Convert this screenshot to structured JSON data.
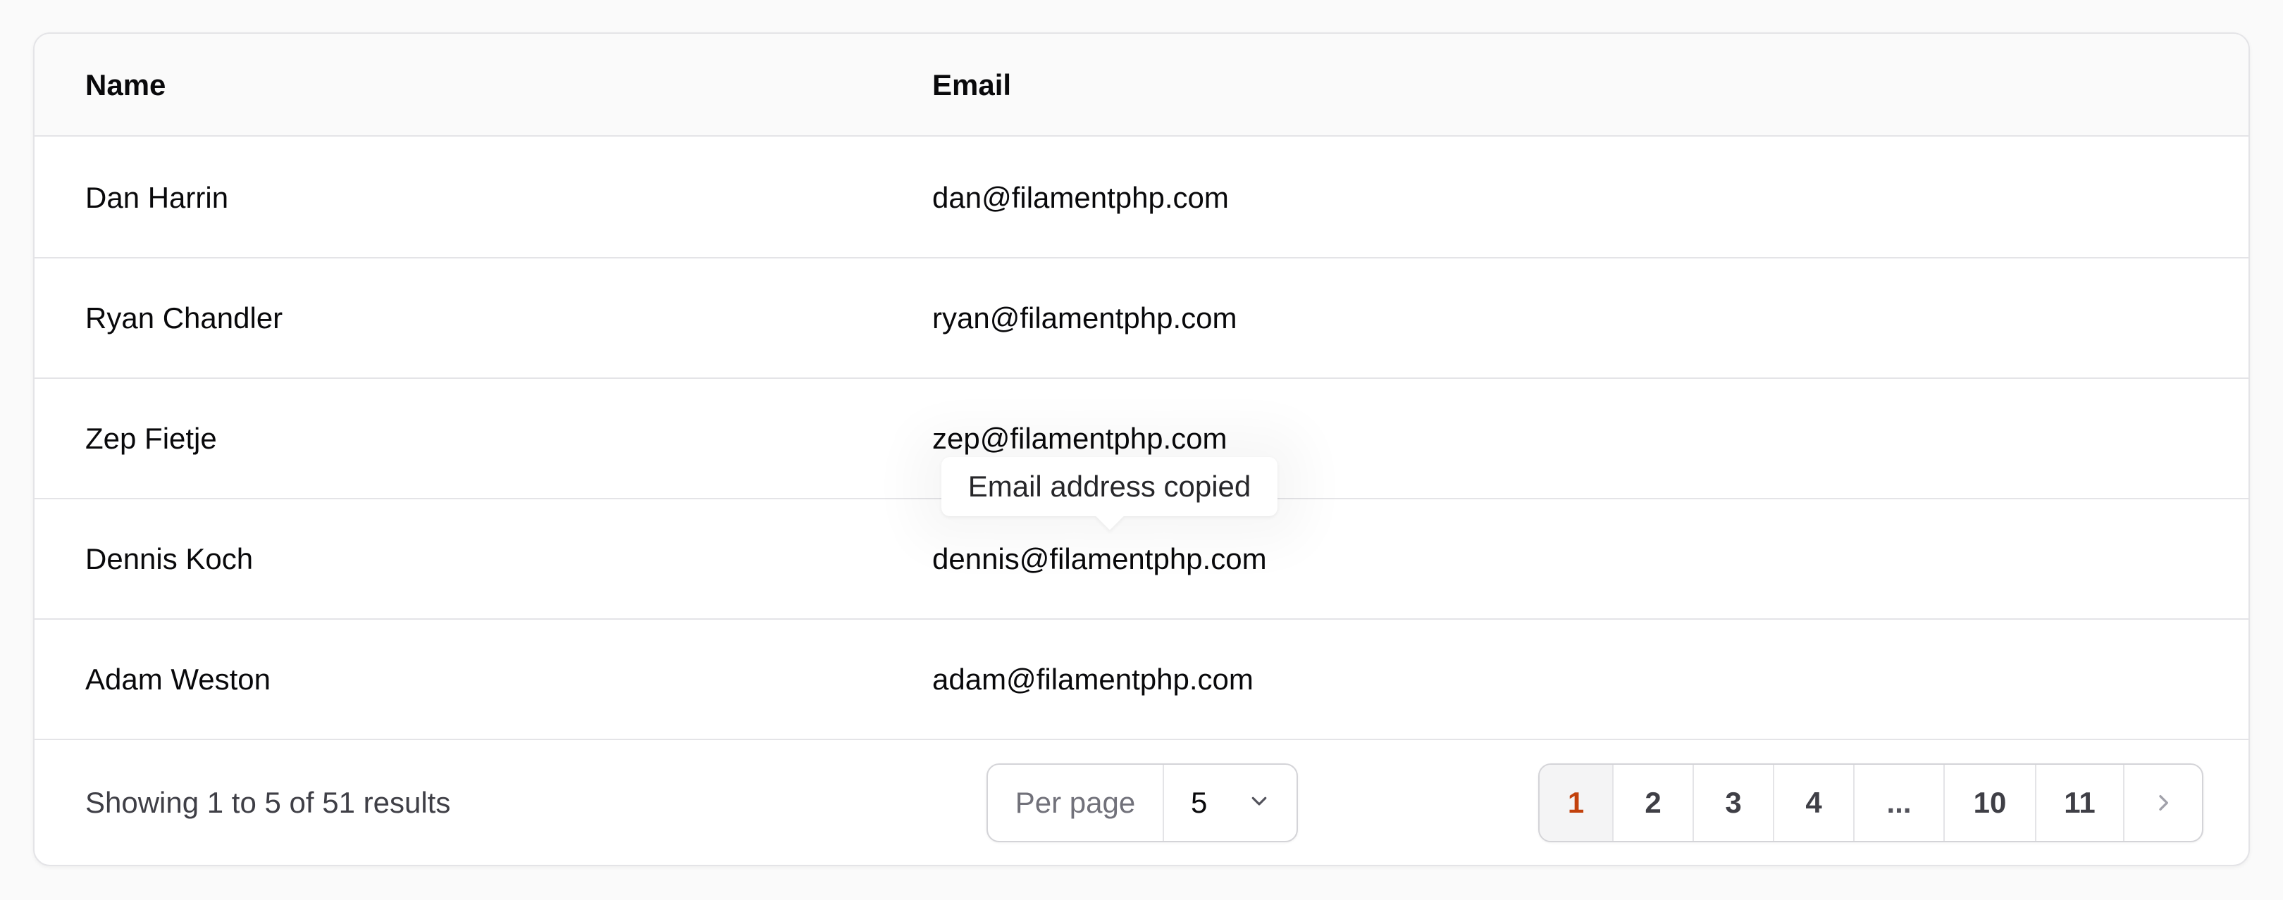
{
  "table": {
    "columns": {
      "name": "Name",
      "email": "Email"
    },
    "rows": [
      {
        "name": "Dan Harrin",
        "email": "dan@filamentphp.com"
      },
      {
        "name": "Ryan Chandler",
        "email": "ryan@filamentphp.com"
      },
      {
        "name": "Zep Fietje",
        "email": "zep@filamentphp.com"
      },
      {
        "name": "Dennis Koch",
        "email": "dennis@filamentphp.com"
      },
      {
        "name": "Adam Weston",
        "email": "adam@filamentphp.com"
      }
    ]
  },
  "tooltip": {
    "text": "Email address copied"
  },
  "footer": {
    "summary": "Showing 1 to 5 of 51 results",
    "per_page_label": "Per page",
    "per_page_value": "5",
    "per_page_icon": "chevron-down-icon",
    "pages": [
      "1",
      "2",
      "3",
      "4",
      "...",
      "10",
      "11"
    ],
    "active_page": "1",
    "next_icon": "chevron-right-icon"
  },
  "colors": {
    "active_page": "#c2410c",
    "border": "#e4e4e7",
    "header_bg": "#fafafa"
  }
}
